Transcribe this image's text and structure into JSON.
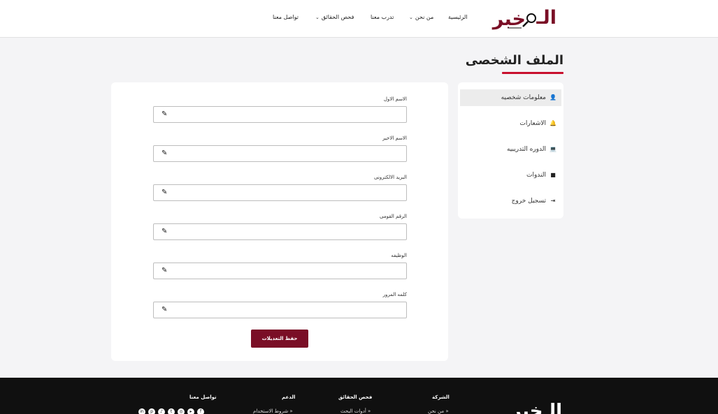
{
  "header": {
    "nav": [
      {
        "label": "الرئيسية",
        "dropdown": false
      },
      {
        "label": "من نحن",
        "dropdown": true
      },
      {
        "label": "تدرب معنا",
        "dropdown": false
      },
      {
        "label": "فحص الحقائق",
        "dropdown": true
      },
      {
        "label": "تواصل معنا",
        "dropdown": false
      }
    ]
  },
  "page": {
    "title": "الملف الشخصى"
  },
  "form": {
    "fields": [
      {
        "label": "الاسم الاول",
        "value": ""
      },
      {
        "label": "الاسم الاخير",
        "value": ""
      },
      {
        "label": "البريد الالكترونى",
        "value": ""
      },
      {
        "label": "الرقم القومى",
        "value": ""
      },
      {
        "label": "الوظيفه",
        "value": ""
      },
      {
        "label": "كلمه المرور",
        "value": ""
      }
    ],
    "save_label": "حفظ التعديلات"
  },
  "side_menu": {
    "items": [
      {
        "label": "معلومات شخصيه",
        "icon": "user-icon",
        "active": true
      },
      {
        "label": "الاشعارات",
        "icon": "bell-icon",
        "active": false
      },
      {
        "label": "الدوره التدريبيه",
        "icon": "laptop-icon",
        "active": false
      },
      {
        "label": "الندوات",
        "icon": "video-icon",
        "active": false
      },
      {
        "label": "تسجيل خروج",
        "icon": "logout-icon",
        "active": false
      }
    ]
  },
  "footer": {
    "columns": [
      {
        "heading": "الشركة",
        "first_link": "من نحن"
      },
      {
        "heading": "فحص الحقائق",
        "first_link": "أدوات البحث"
      },
      {
        "heading": "الدعم",
        "first_link": "شروط الاستخدام"
      },
      {
        "heading": "تواصل معنا",
        "first_link": ""
      }
    ],
    "socials": [
      "linkedin-icon",
      "pinterest-icon",
      "tiktok-icon",
      "twitter-icon",
      "instagram-icon",
      "youtube-icon",
      "facebook-icon"
    ]
  },
  "colors": {
    "brand": "#7a0e26",
    "accent": "#c8102e",
    "footer_bg": "#101010"
  }
}
